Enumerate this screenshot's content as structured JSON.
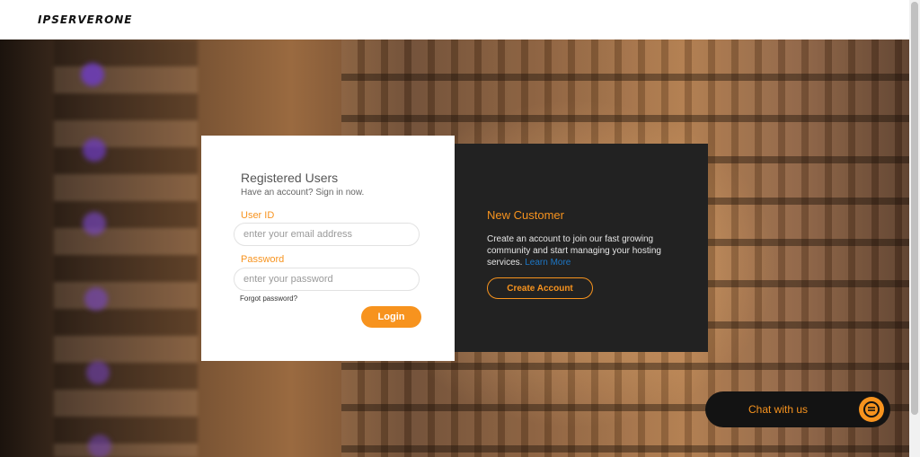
{
  "header": {
    "logo_text": "IPSERVERONE"
  },
  "login": {
    "title": "Registered Users",
    "subtitle": "Have an account? Sign in now.",
    "user_id_label": "User ID",
    "user_id_placeholder": "enter your email address",
    "password_label": "Password",
    "password_placeholder": "enter your password",
    "forgot_password": "Forgot password?",
    "login_button": "Login"
  },
  "new_customer": {
    "title": "New Customer",
    "description": "Create an account to join our fast growing community and start managing your hosting services.",
    "learn_more": "Learn More",
    "create_button": "Create Account"
  },
  "chat": {
    "label": "Chat with us",
    "icon": "chat-bubble-icon"
  },
  "colors": {
    "accent": "#f7931e",
    "dark_panel": "#222222",
    "link": "#1d77c6"
  }
}
